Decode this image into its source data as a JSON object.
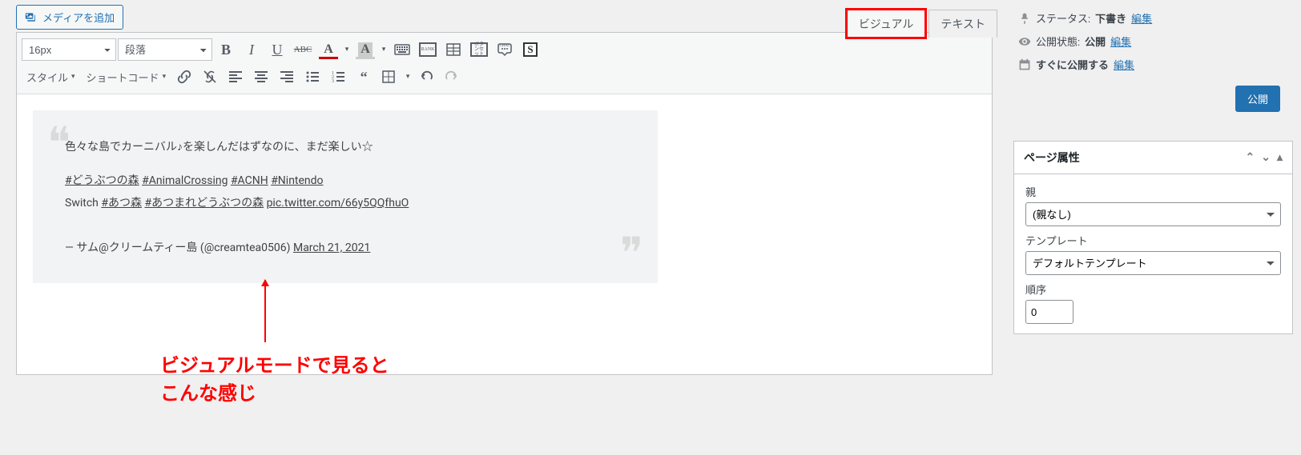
{
  "media_button": "メディアを追加",
  "tabs": {
    "visual": "ビジュアル",
    "text": "テキスト"
  },
  "toolbar": {
    "font_size": "16px",
    "format": "段落",
    "style_label": "スタイル",
    "shortcode_label": "ショートコード"
  },
  "content": {
    "line1": "色々な島でカーニバル♪を楽しんだはずなのに、まだ楽しい☆",
    "hashtags": {
      "h1": "#どうぶつの森",
      "h2": "#AnimalCrossing",
      "h3": "#ACNH",
      "h4": "#Nintendo"
    },
    "line2_prefix": "Switch ",
    "line2_h5": "#あつ森",
    "line2_h6": "#あつまれどうぶつの森",
    "pic_link": "pic.twitter.com/66y5QQfhuO",
    "sig_prefix": "— サム@クリームティー島 (@creamtea0506) ",
    "sig_date": "March 21, 2021"
  },
  "annotation": "ビジュアルモードで見ると\nこんな感じ",
  "sidebar": {
    "status_label": "ステータス:",
    "status_value": "下書き",
    "visibility_label": "公開状態:",
    "visibility_value": "公開",
    "schedule_label": "すぐに公開する",
    "edit": "編集",
    "publish": "公開",
    "page_attrs_title": "ページ属性",
    "parent_label": "親",
    "parent_value": "(親なし)",
    "template_label": "テンプレート",
    "template_value": "デフォルトテンプレート",
    "order_label": "順序",
    "order_value": "0"
  }
}
